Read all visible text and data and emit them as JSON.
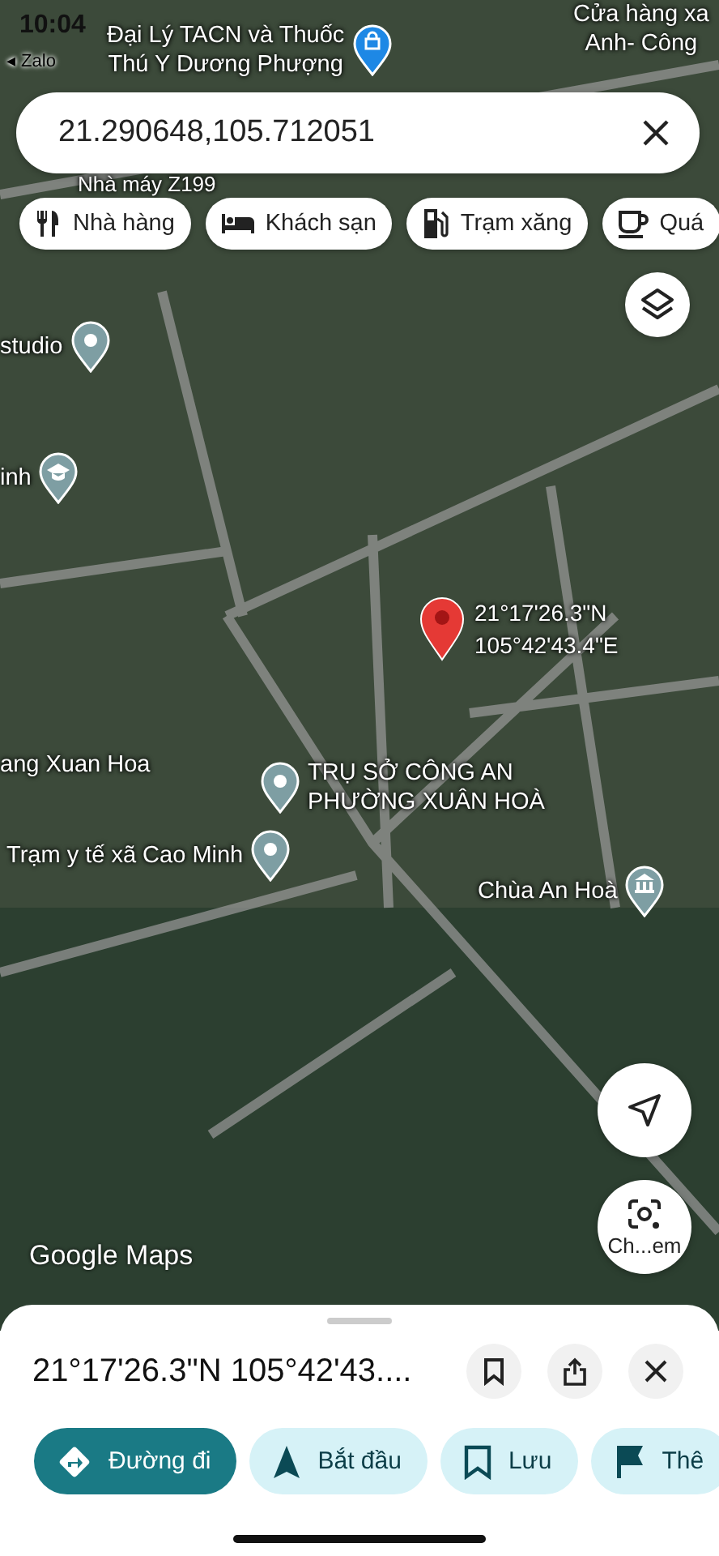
{
  "status_bar": {
    "time": "10:04",
    "back_app": "◂ Zalo"
  },
  "search": {
    "value": "21.290648,105.712051"
  },
  "categories": [
    {
      "label": "Nhà hàng",
      "kind": "restaurant"
    },
    {
      "label": "Khách sạn",
      "kind": "hotel"
    },
    {
      "label": "Trạm xăng",
      "kind": "gas"
    },
    {
      "label": "Quá",
      "kind": "cafe"
    }
  ],
  "map": {
    "places": [
      {
        "lines": [
          "Đại Lý TACN và Thuốc",
          "Thú Y Dương Phượng"
        ],
        "kind": "shop"
      },
      {
        "lines": [
          "Cửa hàng xa",
          "Anh- Công"
        ],
        "kind": "label"
      },
      {
        "lines": [
          "Nhà máy Z199"
        ],
        "kind": "label"
      },
      {
        "lines": [
          "studio"
        ],
        "kind": "place"
      },
      {
        "lines": [
          "inh"
        ],
        "kind": "school"
      },
      {
        "lines": [
          "ang Xuan Hoa"
        ],
        "kind": "label"
      },
      {
        "lines": [
          "TRỤ SỞ CÔNG AN",
          "PHƯỜNG XUÂN HOÀ"
        ],
        "kind": "place"
      },
      {
        "lines": [
          "Trạm y tế xã Cao Minh"
        ],
        "kind": "place"
      },
      {
        "lines": [
          "Chùa An Hoà"
        ],
        "kind": "temple"
      }
    ],
    "dropped_pin": {
      "lines": [
        "21°17'26.3\"N",
        "105°42'43.4\"E"
      ]
    },
    "logo": "Google Maps",
    "camera_button": {
      "label": "Ch...em"
    }
  },
  "place_sheet": {
    "title": "21°17'26.3\"N 105°42'43....",
    "actions": [
      {
        "label": "Đường đi",
        "kind": "directions",
        "primary": true
      },
      {
        "label": "Bắt đầu",
        "kind": "start",
        "primary": false
      },
      {
        "label": "Lưu",
        "kind": "save",
        "primary": false
      },
      {
        "label": "Thê",
        "kind": "flag",
        "primary": false
      }
    ]
  }
}
